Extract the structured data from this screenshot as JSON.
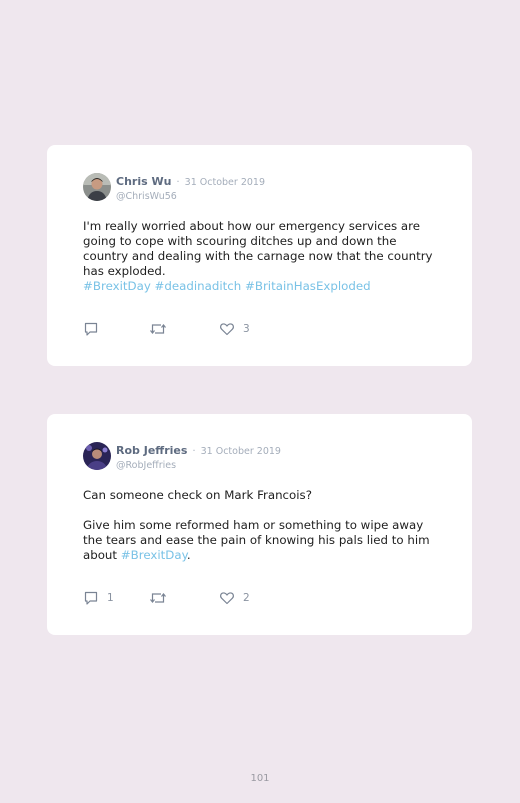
{
  "tweets": [
    {
      "name": "Chris Wu",
      "separator": "·",
      "date": "31 October 2019",
      "handle": "@ChrisWu56",
      "paragraphs": [
        "I'm really worried about how our emergency services are going to cope with scouring ditches up and down the country and dealing with the carnage now that the country has exploded."
      ],
      "hashtags": "#BrexitDay #deadinaditch #BritainHasExploded",
      "reply_count": "",
      "retweet_count": "",
      "like_count": "3"
    },
    {
      "name": "Rob Jeffries",
      "separator": "·",
      "date": "31 October 2019",
      "handle": "@RobJeffries",
      "paragraph1": "Can someone check on Mark Francois?",
      "paragraph2_prefix": "Give him some reformed ham or something to wipe away the tears and ease the pain of knowing his pals lied to him about ",
      "paragraph2_tag": "#BrexitDay",
      "paragraph2_suffix": ".",
      "reply_count": "1",
      "retweet_count": "",
      "like_count": "2"
    }
  ],
  "page_number": "101",
  "colors": {
    "background": "#efe7ee",
    "card": "#ffffff",
    "hashtag": "#79c2e6",
    "name": "#5e6b80",
    "muted": "#a4adba"
  },
  "icons": [
    "reply-icon",
    "retweet-icon",
    "heart-icon"
  ]
}
